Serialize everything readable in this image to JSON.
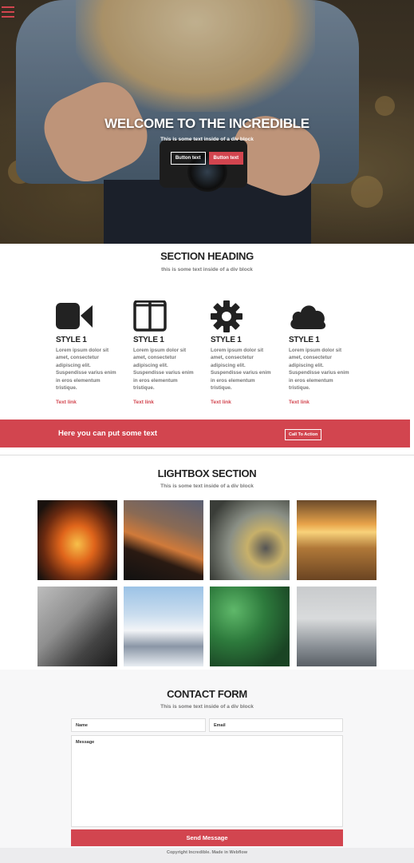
{
  "hero": {
    "title": "WELCOME TO THE INCREDIBLE",
    "subtitle": "This is some text inside of a div block",
    "button1": "Button text",
    "button2": "Button text",
    "accent": "#d2454f"
  },
  "features_section": {
    "heading": "SECTION HEADING",
    "subtitle": "this is some text inside of a div block",
    "items": [
      {
        "icon": "video-camera-icon",
        "title": "STYLE 1",
        "text": "Lorem ipsum dolor sit amet, consectetur adipiscing elit. Suspendisse varius enim in eros elementum tristique.",
        "link": "Text link"
      },
      {
        "icon": "columns-icon",
        "title": "STYLE 1",
        "text": "Lorem ipsum dolor sit amet, consectetur adipiscing elit. Suspendisse varius enim in eros elementum tristique.",
        "link": "Text link"
      },
      {
        "icon": "gear-icon",
        "title": "STYLE 1",
        "text": "Lorem ipsum dolor sit amet, consectetur adipiscing elit. Suspendisse varius enim in eros elementum tristique.",
        "link": "Text link"
      },
      {
        "icon": "cloud-icon",
        "title": "STYLE 1",
        "text": "Lorem ipsum dolor sit amet, consectetur adipiscing elit. Suspendisse varius enim in eros elementum tristique.",
        "link": "Text link"
      }
    ]
  },
  "cta": {
    "text": "Here you can put some text",
    "button": "Call To Action"
  },
  "lightbox": {
    "heading": "LIGHTBOX SECTION",
    "subtitle": "This is some text inside of a div block",
    "images": [
      "campfire-image",
      "sunset-silhouette-image",
      "bicycle-wheel-image",
      "desert-car-image",
      "piano-hands-image",
      "snowy-mountain-image",
      "green-leaves-image",
      "seagulls-image"
    ]
  },
  "contact": {
    "heading": "CONTACT FORM",
    "subtitle": "This is some text inside of a div block",
    "name_placeholder": "Name",
    "email_placeholder": "Email",
    "message_placeholder": "Message",
    "send_label": "Send Message"
  },
  "footer": {
    "text": "Copyright Incredible. Made in Webflow"
  }
}
